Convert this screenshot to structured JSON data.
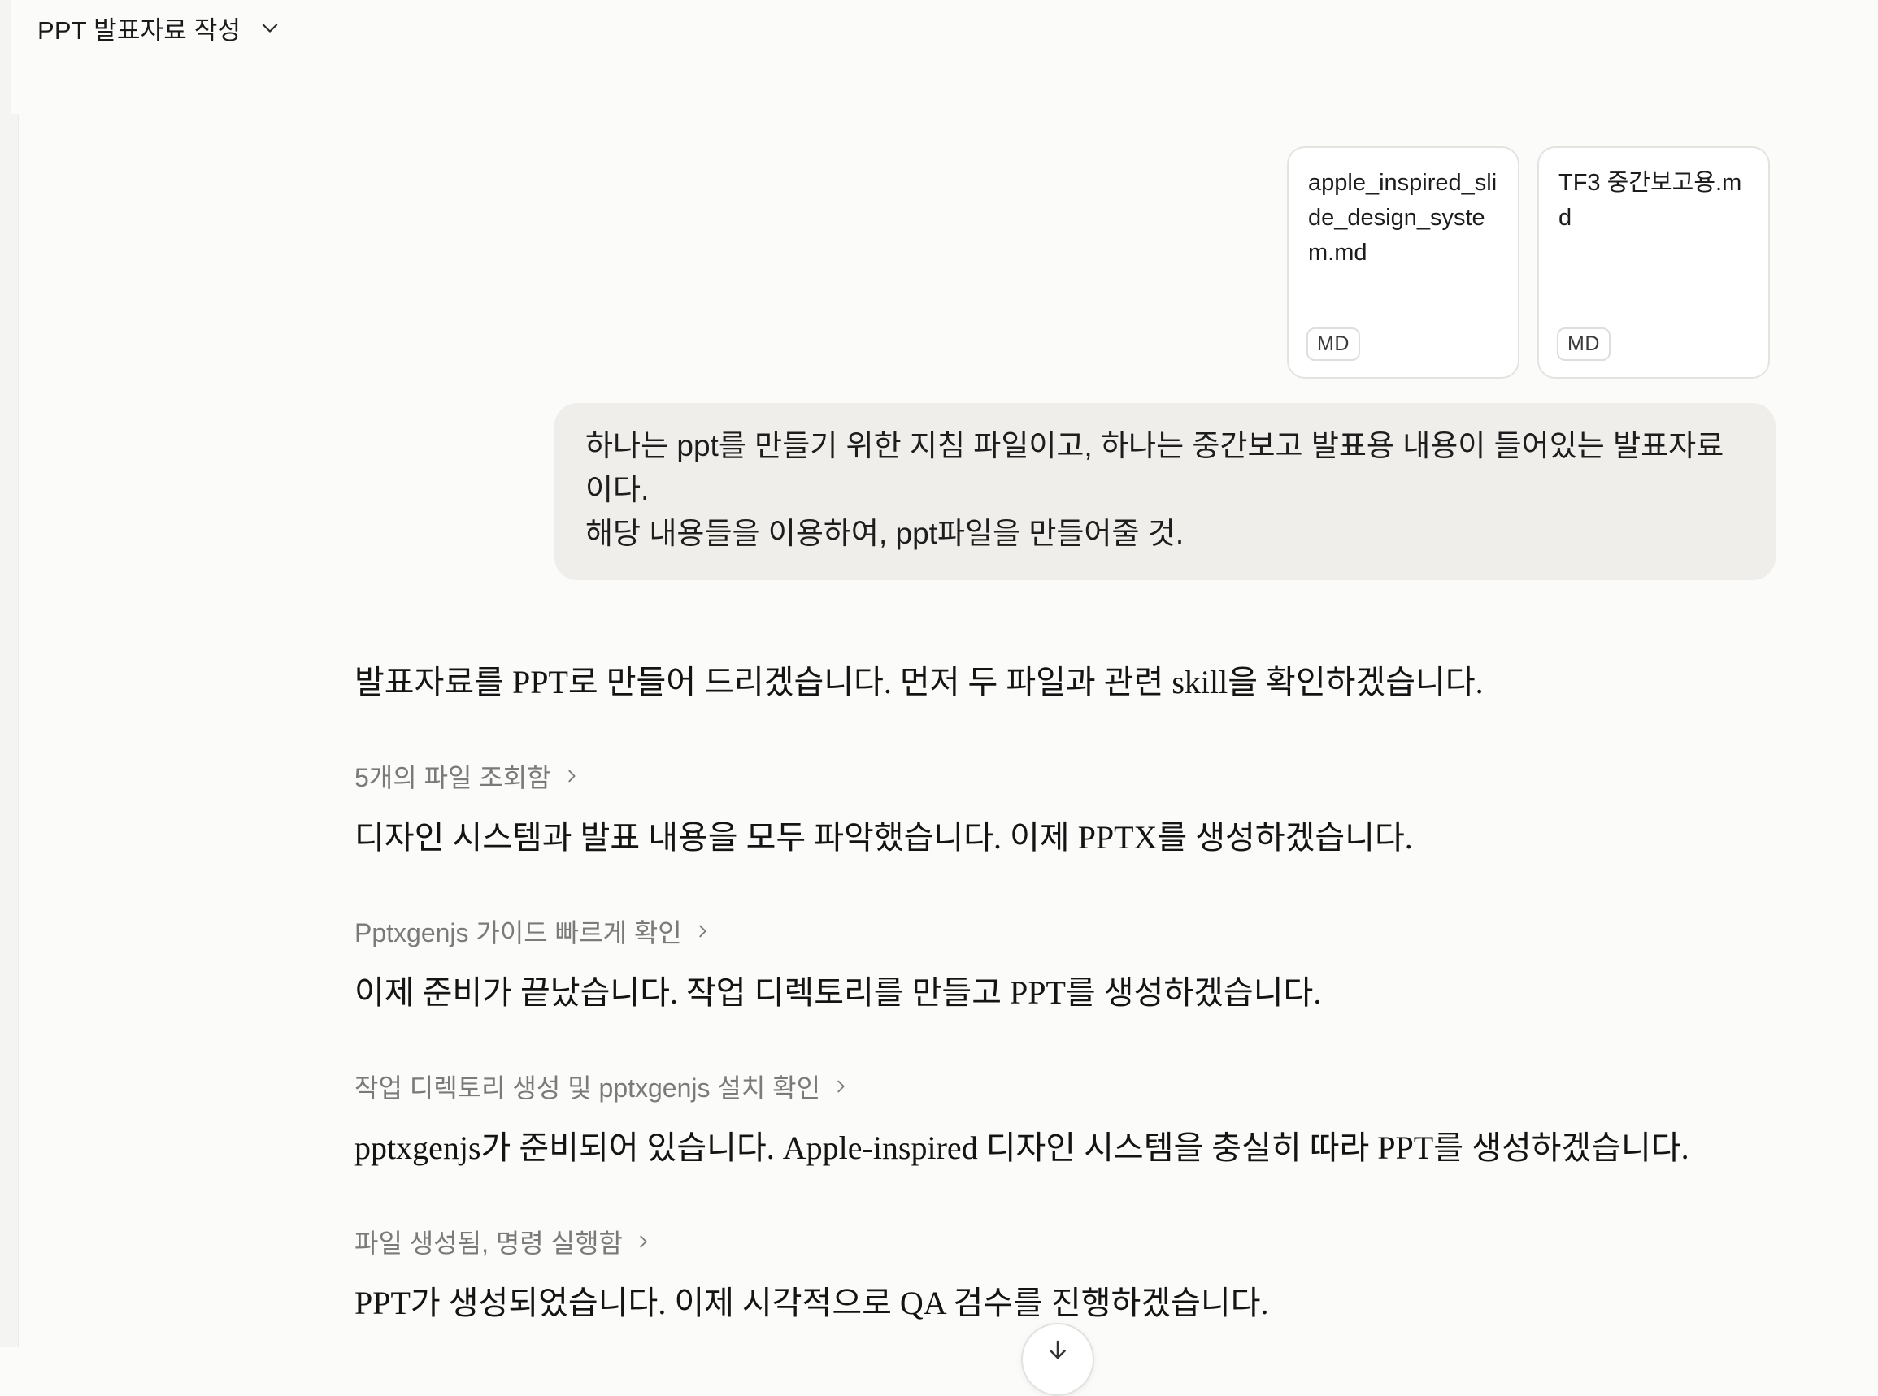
{
  "header": {
    "title": "PPT 발표자료 작성"
  },
  "attachments": [
    {
      "name": "apple_inspired_slide_design_system.md",
      "badge": "MD"
    },
    {
      "name": "TF3 중간보고용.md",
      "badge": "MD"
    }
  ],
  "user_message": {
    "line1": "하나는 ppt를 만들기 위한 지침 파일이고, 하나는 중간보고 발표용 내용이 들어있는 발표자료 이다.",
    "line2": "해당 내용들을 이용하여, ppt파일을 만들어줄 것."
  },
  "assistant": {
    "messages": [
      "발표자료를 PPT로 만들어 드리겠습니다. 먼저 두 파일과 관련 skill을 확인하겠습니다.",
      "디자인 시스템과 발표 내용을 모두 파악했습니다. 이제 PPTX를 생성하겠습니다.",
      "이제 준비가 끝났습니다. 작업 디렉토리를 만들고 PPT를 생성하겠습니다.",
      "pptxgenjs가 준비되어 있습니다. Apple-inspired 디자인 시스템을 충실히 따라 PPT를 생성하겠습니다.",
      "PPT가 생성되었습니다. 이제 시각적으로 QA 검수를 진행하겠습니다."
    ],
    "steps": [
      "5개의 파일 조회함",
      "Pptxgenjs 가이드 빠르게 확인",
      "작업 디렉토리 생성 및 pptxgenjs 설치 확인",
      "파일 생성됨, 명령 실행함"
    ]
  },
  "icons": {
    "title_dropdown": "chevron-down-icon",
    "step_expand": "chevron-right-icon",
    "scroll_down": "arrow-down-icon"
  },
  "colors": {
    "background": "#fbfbfa",
    "bubble": "#efeeeb",
    "step_text": "#7a7a77",
    "card_border": "#e3e3e0"
  }
}
